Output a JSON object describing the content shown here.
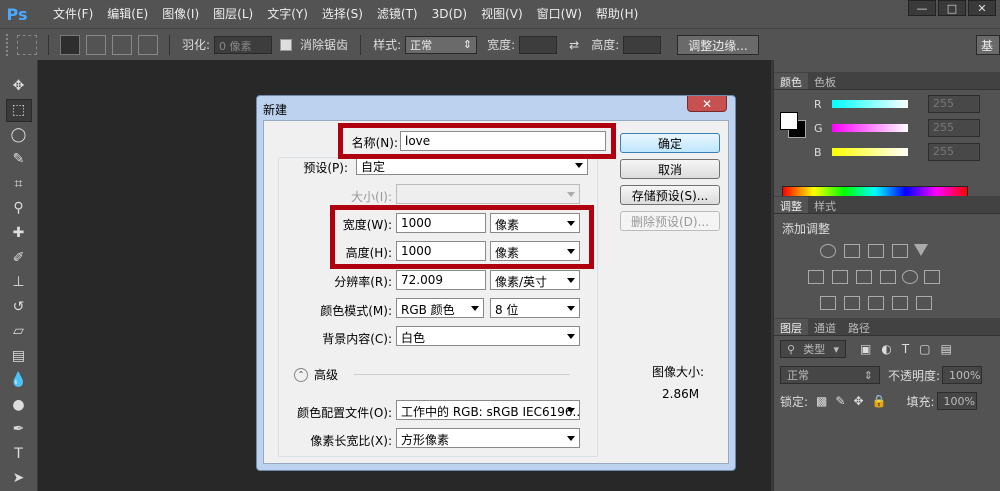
{
  "app": {
    "logo": "Ps"
  },
  "menu": [
    "文件(F)",
    "编辑(E)",
    "图像(I)",
    "图层(L)",
    "文字(Y)",
    "选择(S)",
    "滤镜(T)",
    "3D(D)",
    "视图(V)",
    "窗口(W)",
    "帮助(H)"
  ],
  "window_controls": {
    "minimize": "—",
    "maximize": "□",
    "close": "✕"
  },
  "options": {
    "feather_label": "羽化:",
    "feather_value": "0 像素",
    "antialias_label": "消除锯齿",
    "style_label": "样式:",
    "style_value": "正常",
    "width_label": "宽度:",
    "height_label": "高度:",
    "refine_edge": "调整边缘...",
    "workspace": "基"
  },
  "panels": {
    "color_tabs": [
      "颜色",
      "色板"
    ],
    "color": {
      "r_label": "R",
      "r_value": "255",
      "g_label": "G",
      "g_value": "255",
      "b_label": "B",
      "b_value": "255"
    },
    "adj_tabs": [
      "调整",
      "样式"
    ],
    "adj_title": "添加调整",
    "layer_tabs": [
      "图层",
      "通道",
      "路径"
    ],
    "layers": {
      "kind_label": "类型",
      "blend_mode": "正常",
      "opacity_label": "不透明度:",
      "opacity_value": "100%",
      "lock_label": "锁定:",
      "fill_label": "填充:",
      "fill_value": "100%"
    }
  },
  "dialog": {
    "title": "新建",
    "close": "✕",
    "name_label": "名称(N):",
    "name_value": "love",
    "preset_label": "预设(P):",
    "preset_value": "自定",
    "size_label": "大小(I):",
    "width_label": "宽度(W):",
    "width_value": "1000",
    "width_unit": "像素",
    "height_label": "高度(H):",
    "height_value": "1000",
    "height_unit": "像素",
    "resolution_label": "分辨率(R):",
    "resolution_value": "72.009",
    "resolution_unit": "像素/英寸",
    "color_mode_label": "颜色模式(M):",
    "color_mode_value": "RGB 颜色",
    "bit_depth": "8 位",
    "background_label": "背景内容(C):",
    "background_value": "白色",
    "advanced_label": "高级",
    "color_profile_label": "颜色配置文件(O):",
    "color_profile_value": "工作中的 RGB: sRGB IEC6196...",
    "pixel_aspect_label": "像素长宽比(X):",
    "pixel_aspect_value": "方形像素",
    "ok": "确定",
    "cancel": "取消",
    "save_preset": "存储预设(S)...",
    "delete_preset": "删除预设(D)...",
    "image_size_label": "图像大小:",
    "image_size_value": "2.86M"
  }
}
